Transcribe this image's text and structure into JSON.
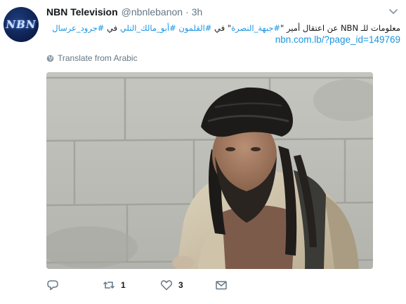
{
  "tweet": {
    "avatar_text": "NBN",
    "display_name": "NBN Television",
    "handle": "@nbnlebanon",
    "separator": "·",
    "time": "3h",
    "text_plain_1": "معلومات للـ NBN عن اعتقال أمير \"",
    "hashtag_1": "#جبهة_النصرة",
    "text_plain_2": "\" في ",
    "hashtag_2": "#القلمون",
    "text_plain_3": " ",
    "hashtag_3": "#أبو_مالك_التلي",
    "text_plain_4": " في ",
    "hashtag_4": "#جرود_عرسال",
    "link": "nbn.com.lb/?page_id=149769",
    "translate_label": "Translate from Arabic",
    "icons": {
      "globe": "globe-icon",
      "caret": "chevron-down-icon",
      "reply": "reply-icon",
      "retweet": "retweet-icon",
      "like": "heart-icon",
      "message": "envelope-icon"
    }
  },
  "actions": {
    "retweet_count": "1",
    "like_count": "3"
  },
  "colors": {
    "link": "#1b95e0",
    "muted": "#657786",
    "text": "#14171a"
  }
}
